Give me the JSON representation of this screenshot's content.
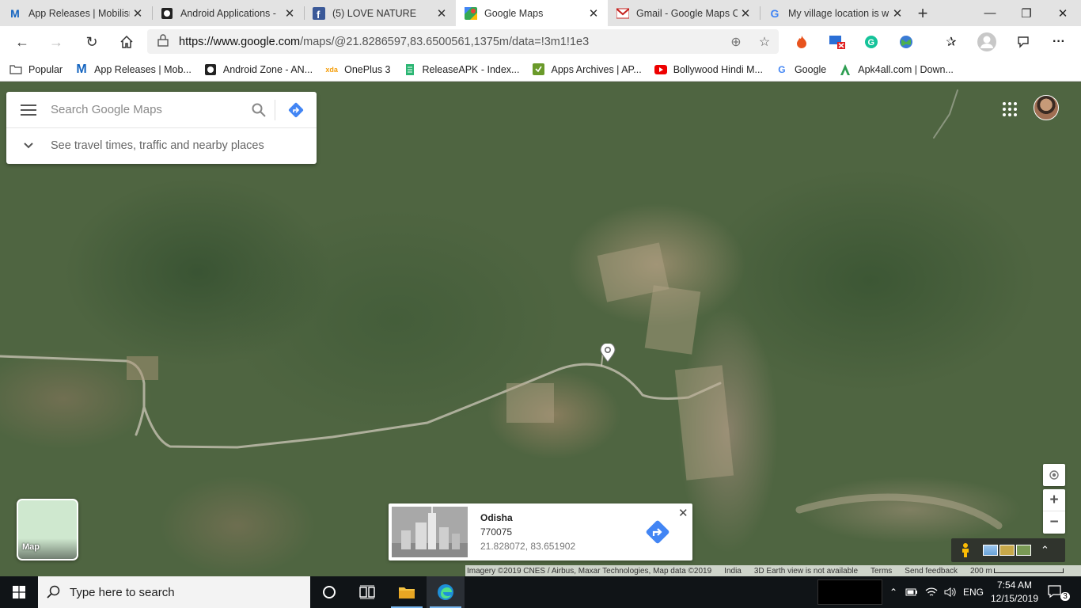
{
  "browser": {
    "tabs": [
      {
        "title": "App Releases | Mobilisn",
        "favicon": "m-icon",
        "active": false
      },
      {
        "title": "Android Applications -",
        "favicon": "android-icon",
        "active": false
      },
      {
        "title": "(5) LOVE NATURE",
        "favicon": "facebook-icon",
        "active": false
      },
      {
        "title": "Google Maps",
        "favicon": "maps-icon",
        "active": true
      },
      {
        "title": "Gmail - Google Maps C",
        "favicon": "gmail-icon",
        "active": false
      },
      {
        "title": "My village location is w",
        "favicon": "google-icon",
        "active": false
      }
    ],
    "url_prefix": "https://www.google.com",
    "url_rest": "/maps/@21.8286597,83.6500561,1375m/data=!3m1!1e3",
    "bookmarks": [
      {
        "label": "Popular",
        "icon": "folder-icon"
      },
      {
        "label": "App Releases | Mob...",
        "icon": "m-icon"
      },
      {
        "label": "Android Zone - AN...",
        "icon": "android-icon"
      },
      {
        "label": "OnePlus 3",
        "icon": "xda-icon"
      },
      {
        "label": "ReleaseAPK - Index...",
        "icon": "releaseapk-icon"
      },
      {
        "label": "Apps Archives | AP...",
        "icon": "apps-icon"
      },
      {
        "label": "Bollywood Hindi M...",
        "icon": "youtube-icon"
      },
      {
        "label": "Google",
        "icon": "google-icon"
      },
      {
        "label": "Apk4all.com | Down...",
        "icon": "apk4all-icon"
      }
    ]
  },
  "maps": {
    "search_placeholder": "Search Google Maps",
    "travel_text": "See travel times, traffic and nearby places",
    "layer_label": "Map",
    "place": {
      "name": "Odisha",
      "postal": "770075",
      "coords": "21.828072, 83.651902"
    },
    "attribution": {
      "imagery": "Imagery ©2019 CNES / Airbus, Maxar Technologies, Map data ©2019",
      "country": "India",
      "earth": "3D Earth view is not available",
      "terms": "Terms",
      "feedback": "Send feedback",
      "scale": "200 m"
    }
  },
  "taskbar": {
    "search_placeholder": "Type here to search",
    "language": "ENG",
    "time": "7:54 AM",
    "date": "12/15/2019",
    "notifications": "3"
  },
  "colors": {
    "maps_blue": "#4285f4",
    "tab_bar": "#e3e3e3",
    "taskbar": "#101417"
  }
}
